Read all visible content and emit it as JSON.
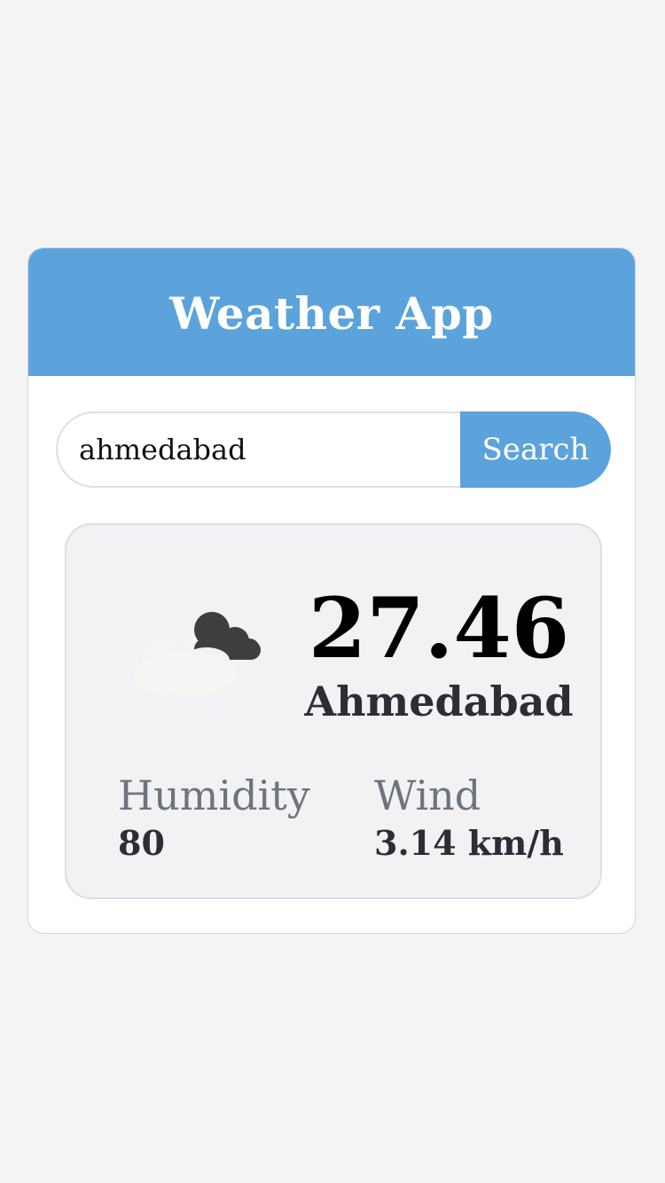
{
  "app": {
    "title": "Weather App"
  },
  "search": {
    "value": "ahmedabad",
    "button_label": "Search"
  },
  "weather": {
    "icon": "partly-cloudy-icon",
    "temperature": "27.46",
    "city": "Ahmedabad",
    "humidity_label": "Humidity",
    "humidity_value": "80",
    "wind_label": "Wind",
    "wind_value": "3.14 km/h"
  },
  "colors": {
    "header": "#5ca3dc",
    "button": "#5ca3dc",
    "panel": "#f2f2f4"
  }
}
